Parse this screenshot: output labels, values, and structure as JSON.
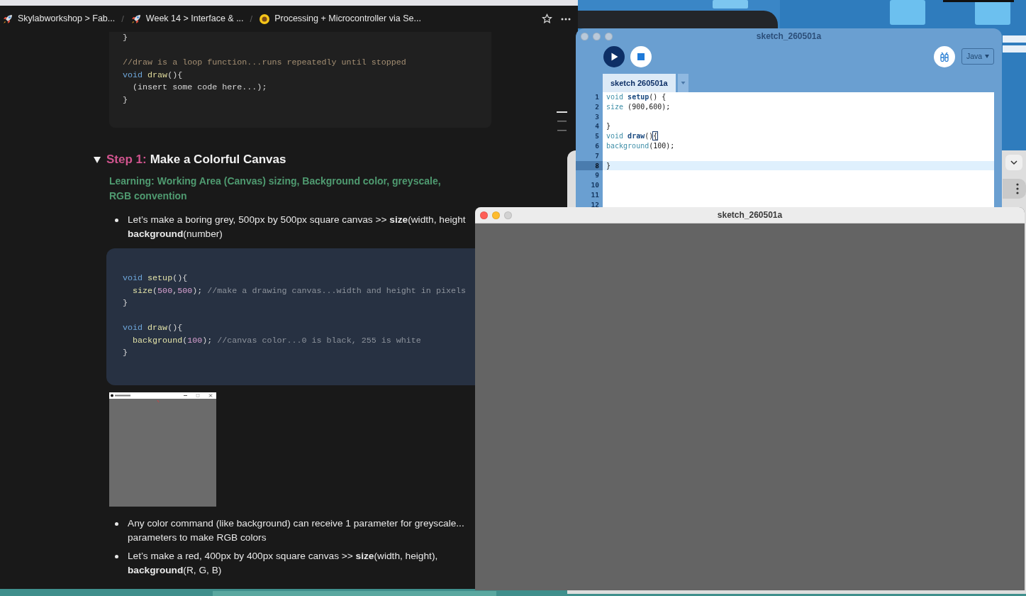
{
  "browser": {
    "breadcrumbs": [
      {
        "kind": "crumb",
        "label": "Skylabworkshop > Fab..."
      },
      {
        "kind": "separator",
        "label": "/"
      },
      {
        "kind": "crumb",
        "label": "Week 14 > Interface & ..."
      },
      {
        "kind": "separator",
        "label": "/"
      },
      {
        "kind": "crumb",
        "label": "Processing + Microcontroller via Se..."
      }
    ],
    "blocks": [
      {
        "kind": "code",
        "lines": [
          {
            "kind": "line",
            "tokens": [
              {
                "kind": "plain",
                "text": "}"
              }
            ]
          },
          {
            "kind": "blank"
          },
          {
            "kind": "line",
            "tokens": [
              {
                "kind": "comment",
                "text": "//draw is a loop function...runs repeatedly until stopped"
              }
            ]
          },
          {
            "kind": "line",
            "tokens": [
              {
                "kind": "keyword",
                "text": "void "
              },
              {
                "kind": "function",
                "text": "draw"
              },
              {
                "kind": "plain",
                "text": "(){"
              }
            ]
          },
          {
            "kind": "line",
            "tokens": [
              {
                "kind": "plain",
                "text": "  (insert some code here...);"
              }
            ]
          },
          {
            "kind": "line",
            "tokens": [
              {
                "kind": "plain",
                "text": "}"
              }
            ]
          }
        ]
      },
      {
        "kind": "toggle_heading",
        "expanded": true,
        "label": "Step 1:",
        "title": "Make a Colorful Canvas",
        "subtitle": "Learning: Working Area (Canvas) sizing, Background color, greyscale, RGB convention"
      },
      {
        "kind": "bullets",
        "items": [
          "Let’s make a boring grey, 500px by 500px square canvas >> **size**(width, height\n**background**(number)"
        ]
      },
      {
        "kind": "code_callout",
        "lines": [
          {
            "kind": "line",
            "tokens": [
              {
                "kind": "keyword",
                "text": "void "
              },
              {
                "kind": "function",
                "text": "setup"
              },
              {
                "kind": "plain",
                "text": "(){"
              }
            ]
          },
          {
            "kind": "line",
            "tokens": [
              {
                "kind": "function",
                "text": "  size"
              },
              {
                "kind": "plain",
                "text": "("
              },
              {
                "kind": "number",
                "text": "500"
              },
              {
                "kind": "plain",
                "text": ","
              },
              {
                "kind": "number",
                "text": "500"
              },
              {
                "kind": "plain",
                "text": "); "
              },
              {
                "kind": "comment",
                "text": "//make a drawing canvas...width and height in pixels"
              }
            ]
          },
          {
            "kind": "line",
            "tokens": [
              {
                "kind": "plain",
                "text": "}"
              }
            ]
          },
          {
            "kind": "blank"
          },
          {
            "kind": "line",
            "tokens": [
              {
                "kind": "keyword",
                "text": "void "
              },
              {
                "kind": "function",
                "text": "draw"
              },
              {
                "kind": "plain",
                "text": "(){"
              }
            ]
          },
          {
            "kind": "line",
            "tokens": [
              {
                "kind": "function",
                "text": "  background"
              },
              {
                "kind": "plain",
                "text": "("
              },
              {
                "kind": "number",
                "text": "100"
              },
              {
                "kind": "plain",
                "text": "); "
              },
              {
                "kind": "comment",
                "text": "//canvas color...0 is black, 255 is white"
              }
            ]
          },
          {
            "kind": "line",
            "tokens": [
              {
                "kind": "plain",
                "text": "}"
              }
            ]
          }
        ]
      },
      {
        "kind": "image"
      },
      {
        "kind": "bullets",
        "items": [
          "Any color command (like background) can receive 1 parameter for greyscale...\nparameters to make RGB colors",
          "Let’s make a red, 400px by 400px square canvas >> **size**(width, height),\n**background**(R, G, B)"
        ]
      }
    ]
  },
  "ide": {
    "title": "sketch_260501a",
    "active": false,
    "mode": "Java",
    "tabs": [
      {
        "label": "sketch 260501a",
        "selected": true
      }
    ],
    "lines": [
      {
        "number": "1",
        "selected": false,
        "tokens": [
          {
            "kind": "keyword",
            "text": "void "
          },
          {
            "kind": "function",
            "text": "setup"
          },
          {
            "kind": "plain",
            "text": "() {"
          }
        ]
      },
      {
        "number": "2",
        "selected": false,
        "tokens": [
          {
            "kind": "builtin",
            "text": "size"
          },
          {
            "kind": "plain",
            "text": " (900,600);"
          }
        ]
      },
      {
        "number": "3",
        "selected": false
      },
      {
        "number": "4",
        "selected": false,
        "tokens": [
          {
            "kind": "plain",
            "text": "}"
          }
        ]
      },
      {
        "number": "5",
        "selected": false,
        "tokens": [
          {
            "kind": "keyword",
            "text": "void "
          },
          {
            "kind": "function",
            "text": "draw"
          },
          {
            "kind": "plain",
            "text": "()"
          },
          {
            "kind": "bracket_match",
            "text": "{"
          }
        ]
      },
      {
        "number": "6",
        "selected": false,
        "tokens": [
          {
            "kind": "builtin",
            "text": "background"
          },
          {
            "kind": "plain",
            "text": "(100);"
          }
        ]
      },
      {
        "number": "7",
        "selected": false
      },
      {
        "number": "8",
        "selected": true,
        "tokens": [
          {
            "kind": "plain",
            "text": "}"
          }
        ]
      },
      {
        "number": "9",
        "selected": false
      },
      {
        "number": "10",
        "selected": false
      },
      {
        "number": "11",
        "selected": false
      },
      {
        "number": "12",
        "selected": false
      }
    ]
  },
  "sketch_window": {
    "title": "sketch_260501a",
    "active": true
  }
}
